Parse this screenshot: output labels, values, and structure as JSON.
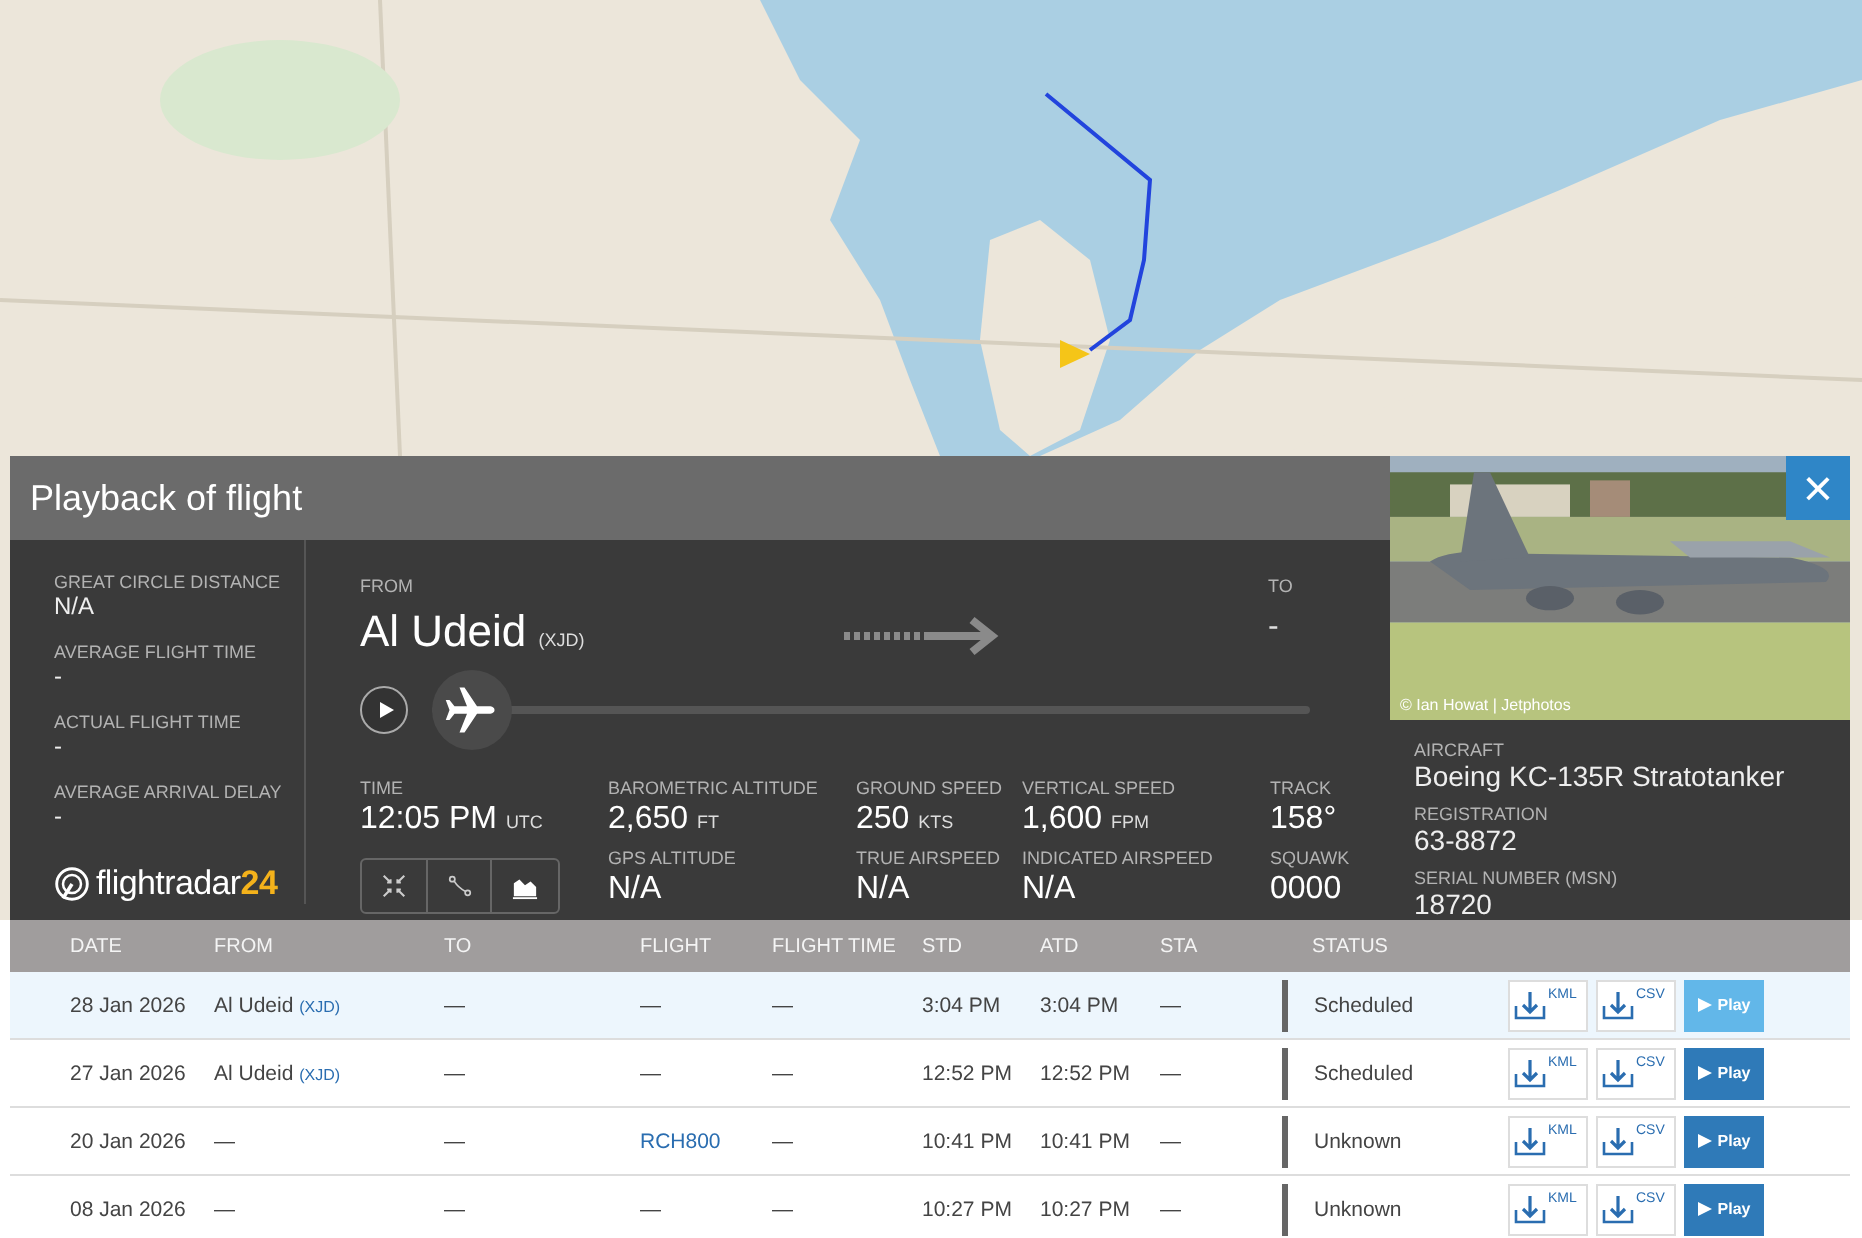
{
  "panel": {
    "title": "Playback of flight",
    "close": "×"
  },
  "summary": [
    {
      "label": "GREAT CIRCLE DISTANCE",
      "value": "N/A"
    },
    {
      "label": "AVERAGE FLIGHT TIME",
      "value": "-"
    },
    {
      "label": "ACTUAL FLIGHT TIME",
      "value": "-"
    },
    {
      "label": "AVERAGE ARRIVAL DELAY",
      "value": "-"
    }
  ],
  "logo": {
    "name": "flightradar",
    "suffix": "24"
  },
  "route": {
    "from_label": "FROM",
    "from": "Al Udeid",
    "from_code": "(XJD)",
    "to_label": "TO",
    "to": "-"
  },
  "playback": {
    "level": 0.0
  },
  "time": {
    "label": "TIME",
    "value": "12:05 PM",
    "unit": "UTC"
  },
  "stats": [
    {
      "label": "BAROMETRIC ALTITUDE",
      "value": "2,650",
      "unit": "FT"
    },
    {
      "label": "GROUND SPEED",
      "value": "250",
      "unit": "KTS"
    },
    {
      "label": "VERTICAL SPEED",
      "value": "1,600",
      "unit": "FPM"
    },
    {
      "label": "TRACK",
      "value": "158°"
    },
    {
      "label": "GPS ALTITUDE",
      "value": "N/A"
    },
    {
      "label": "TRUE AIRSPEED",
      "value": "N/A"
    },
    {
      "label": "INDICATED AIRSPEED",
      "value": "N/A"
    },
    {
      "label": "SQUAWK",
      "value": "0000"
    }
  ],
  "aircraft": {
    "photo_credit": "© Ian Howat | Jetphotos",
    "fields": [
      {
        "label": "AIRCRAFT",
        "value": "Boeing KC-135R Stratotanker"
      },
      {
        "label": "REGISTRATION",
        "value": "63-8872"
      },
      {
        "label": "SERIAL NUMBER (MSN)",
        "value": "18720"
      }
    ]
  },
  "table": {
    "columns": [
      "DATE",
      "FROM",
      "TO",
      "FLIGHT",
      "FLIGHT TIME",
      "STD",
      "ATD",
      "STA",
      "STATUS"
    ],
    "rows": [
      {
        "selected": true,
        "date": "28 Jan 2026",
        "from": "Al Udeid",
        "from_code": "(XJD)",
        "to": "—",
        "flight": "—",
        "flight_linked": false,
        "flight_time": "—",
        "std": "3:04 PM",
        "atd": "3:04 PM",
        "sta": "—",
        "status": "Scheduled",
        "buttons": [
          "KML",
          "CSV",
          "Play"
        ]
      },
      {
        "selected": false,
        "date": "27 Jan 2026",
        "from": "Al Udeid",
        "from_code": "(XJD)",
        "to": "—",
        "flight": "—",
        "flight_linked": false,
        "flight_time": "—",
        "std": "12:52 PM",
        "atd": "12:52 PM",
        "sta": "—",
        "status": "Scheduled",
        "buttons": [
          "KML",
          "CSV",
          "Play"
        ]
      },
      {
        "selected": false,
        "date": "20 Jan 2026",
        "from": "—",
        "to": "—",
        "flight": "RCH800",
        "flight_linked": true,
        "flight_time": "—",
        "std": "10:41 PM",
        "atd": "10:41 PM",
        "sta": "—",
        "status": "Unknown",
        "buttons": [
          "KML",
          "CSV",
          "Play"
        ]
      },
      {
        "selected": false,
        "date": "08 Jan 2026",
        "from": "—",
        "to": "—",
        "flight": "—",
        "flight_linked": false,
        "flight_time": "—",
        "std": "10:27 PM",
        "atd": "10:27 PM",
        "sta": "—",
        "status": "Unknown",
        "buttons": [
          "KML",
          "CSV",
          "Play"
        ]
      }
    ]
  }
}
